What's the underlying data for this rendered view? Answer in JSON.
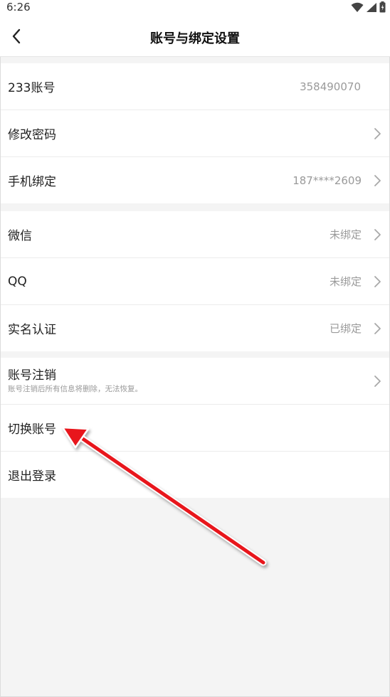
{
  "status_bar": {
    "time": "6:26",
    "icons": [
      "wifi-icon",
      "signal-icon",
      "battery-icon"
    ]
  },
  "header": {
    "title": "账号与绑定设置",
    "back_icon": "chevron-left-icon"
  },
  "groups": [
    {
      "items": [
        {
          "label": "233账号",
          "value": "358490070",
          "chevron": false
        },
        {
          "label": "修改密码",
          "value": "",
          "chevron": true
        },
        {
          "label": "手机绑定",
          "value": "187****2609",
          "chevron": true
        }
      ]
    },
    {
      "items": [
        {
          "label": "微信",
          "value": "未绑定",
          "chevron": true
        },
        {
          "label": "QQ",
          "value": "未绑定",
          "chevron": true
        },
        {
          "label": "实名认证",
          "value": "已绑定",
          "chevron": true
        }
      ]
    },
    {
      "items": [
        {
          "label": "账号注销",
          "sublabel": "账号注销后所有信息将删除，无法恢复。",
          "value": "",
          "chevron": true
        },
        {
          "label": "切换账号",
          "value": "",
          "chevron": false
        },
        {
          "label": "退出登录",
          "value": "",
          "chevron": false
        }
      ]
    }
  ],
  "colors": {
    "background": "#f4f4f4",
    "row_background": "#ffffff",
    "value_text": "#9a9a9a",
    "annotation_arrow": "#e8141b"
  }
}
